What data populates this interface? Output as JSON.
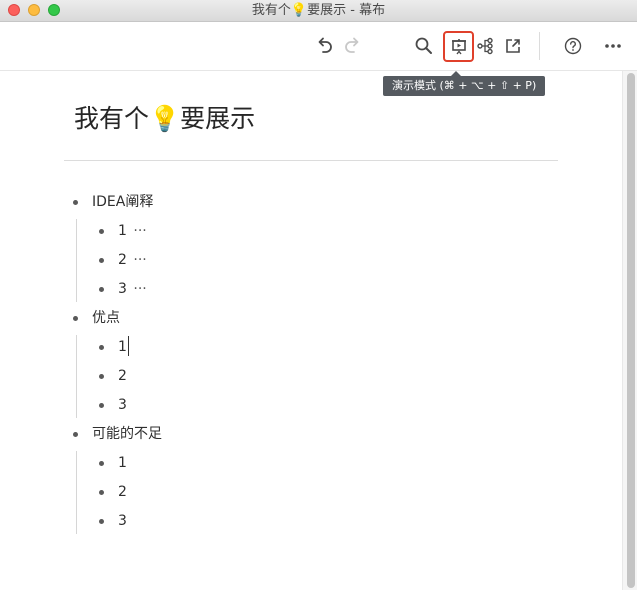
{
  "window": {
    "title": "我有个💡要展示 - 幕布"
  },
  "toolbar": {
    "undo_icon": "undo-icon",
    "redo_icon": "redo-icon",
    "search_icon": "search-icon",
    "presentation_icon": "presentation-icon",
    "mindmap_icon": "mindmap-icon",
    "share_icon": "share-icon",
    "help_icon": "help-icon",
    "more_icon": "more-icon",
    "tooltip": "演示模式 (⌘ + ⌥ + ⇧ + P)"
  },
  "document": {
    "title": "我有个💡要展示",
    "outline": [
      {
        "text": "IDEA阐释",
        "children": [
          {
            "text": "1",
            "suffix": "···"
          },
          {
            "text": "2",
            "suffix": "···"
          },
          {
            "text": "3",
            "suffix": "···"
          }
        ]
      },
      {
        "text": "优点",
        "children": [
          {
            "text": "1"
          },
          {
            "text": "2"
          },
          {
            "text": "3"
          }
        ]
      },
      {
        "text": "可能的不足",
        "children": [
          {
            "text": "1"
          },
          {
            "text": "2"
          },
          {
            "text": "3"
          }
        ]
      }
    ]
  },
  "colors": {
    "active_border": "#e0402b",
    "tooltip_bg": "#555a60",
    "bullet": "#595959"
  }
}
